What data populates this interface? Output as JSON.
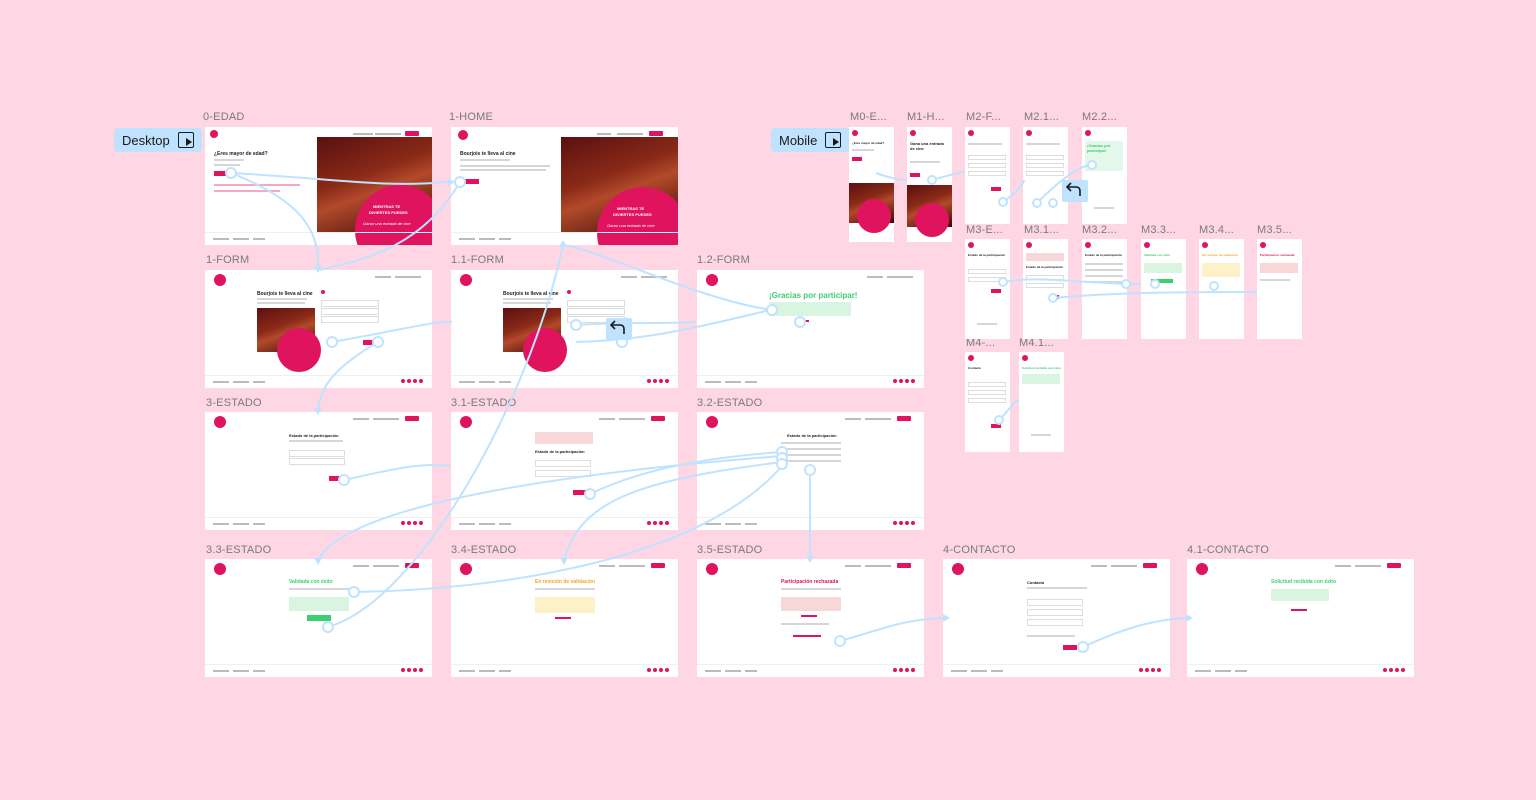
{
  "canvas": {
    "background": "#ffd6e3",
    "accent": "#e0135f",
    "connector_color": "#bfe3ff"
  },
  "flow_buttons": {
    "desktop": "Desktop",
    "mobile": "Mobile"
  },
  "frames": {
    "d0": "0-EDAD",
    "d1": "1-HOME",
    "f1": "1-FORM",
    "f11": "1.1-FORM",
    "f12": "1.2-FORM",
    "e3": "3-ESTADO",
    "e31": "3.1-ESTADO",
    "e32": "3.2-ESTADO",
    "e33": "3.3-ESTADO",
    "e34": "3.4-ESTADO",
    "e35": "3.5-ESTADO",
    "c4": "4-CONTACTO",
    "c41": "4.1-CONTACTO",
    "m0": "M0-E...",
    "m1": "M1-H...",
    "m2": "M2-F...",
    "m21": "M2.1...",
    "m22": "M2.2...",
    "m3": "M3-E...",
    "m31": "M3.1...",
    "m32": "M3.2...",
    "m33": "M3.3...",
    "m34": "M3.4...",
    "m35": "M3.5...",
    "m4": "M4-...",
    "m41": "M4.1..."
  },
  "content": {
    "age_title": "¿Eres mayor de edad?",
    "home_title": "Bourjois te lleva al cine",
    "form_title": "Bourjois te lleva al cine",
    "thanks": "¡Gracias por participar!",
    "status_title": "Estado de la participación",
    "validated": "Validada con éxito",
    "review": "En revisión de validación",
    "rejected": "Participación rechazada",
    "contact": "Contacto",
    "request_sent": "Solicitud recibida con éxito",
    "hero_line1": "MIENTRAS TE",
    "hero_line2": "DIVIERTES PUEDES",
    "hero_script": "Ganar una entrada de cine",
    "mobile_title": "Gana una entrada de cine"
  }
}
